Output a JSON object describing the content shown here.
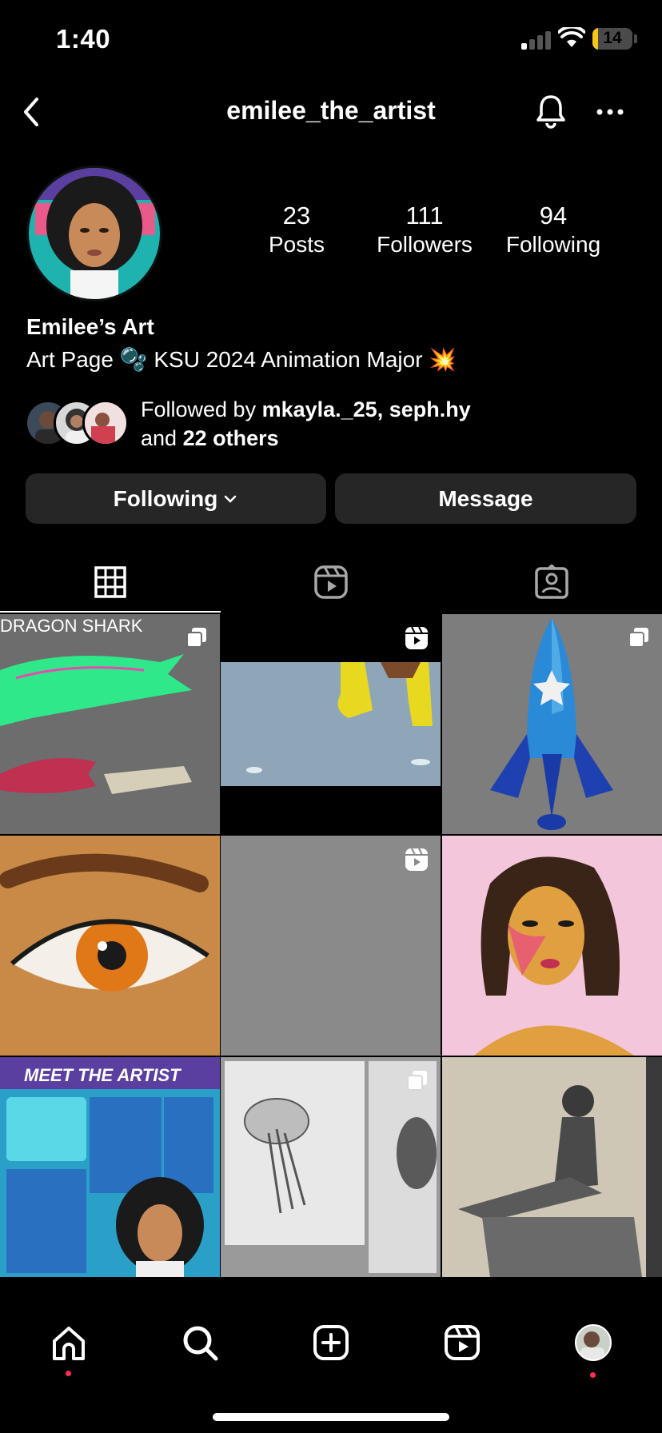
{
  "status_bar": {
    "time": "1:40",
    "battery": "14",
    "battery_level": 0.14
  },
  "header": {
    "username": "emilee_the_artist"
  },
  "profile": {
    "display_name": "Emilee’s Art",
    "bio": "Art Page 🫧 KSU 2024 Animation Major 💥",
    "stats": [
      {
        "value": "23",
        "label": "Posts"
      },
      {
        "value": "111",
        "label": "Followers"
      },
      {
        "value": "94",
        "label": "Following"
      }
    ],
    "followed_by": {
      "prefix": "Followed by ",
      "users": "mkayla._25, seph.hy",
      "and": "and ",
      "others": "22 others"
    }
  },
  "buttons": {
    "following": "Following",
    "message": "Message"
  },
  "tabs": [
    {
      "icon": "grid-icon",
      "active": true
    },
    {
      "icon": "reels-icon",
      "active": false
    },
    {
      "icon": "tagged-icon",
      "active": false
    }
  ],
  "grid_posts": [
    {
      "caption": "DRAGON SHARK",
      "badge": "carousel-icon"
    },
    {
      "caption": "",
      "badge": "reel-icon"
    },
    {
      "caption": "",
      "badge": "carousel-icon"
    },
    {
      "caption": "",
      "badge": ""
    },
    {
      "caption": "",
      "badge": "reel-icon"
    },
    {
      "caption": "",
      "badge": ""
    },
    {
      "caption": "MEET THE ARTIST",
      "badge": ""
    },
    {
      "caption": "",
      "badge": "carousel-icon"
    },
    {
      "caption": "",
      "badge": ""
    }
  ],
  "bottom_nav": [
    "home-icon",
    "search-icon",
    "create-icon",
    "reels-icon",
    "profile-avatar"
  ],
  "colors": {
    "background": "#000000",
    "button": "#262626",
    "notification_dot": "#ff2d55",
    "battery": "#f5c518"
  }
}
